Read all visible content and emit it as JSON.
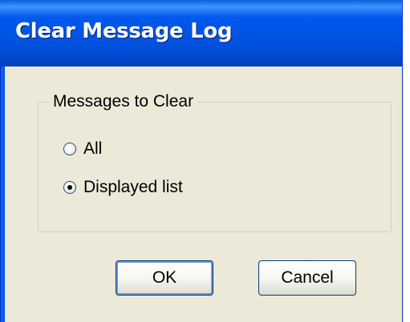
{
  "dialog": {
    "title": "Clear Message Log"
  },
  "group": {
    "label": "Messages to Clear",
    "options": [
      {
        "label": "All",
        "selected": false
      },
      {
        "label": "Displayed list",
        "selected": true
      }
    ]
  },
  "buttons": {
    "ok_label": "OK",
    "cancel_label": "Cancel"
  },
  "colors": {
    "titlebar": "#0054e3",
    "dialog_bg": "#ece9d8",
    "button_border": "#003c74"
  }
}
